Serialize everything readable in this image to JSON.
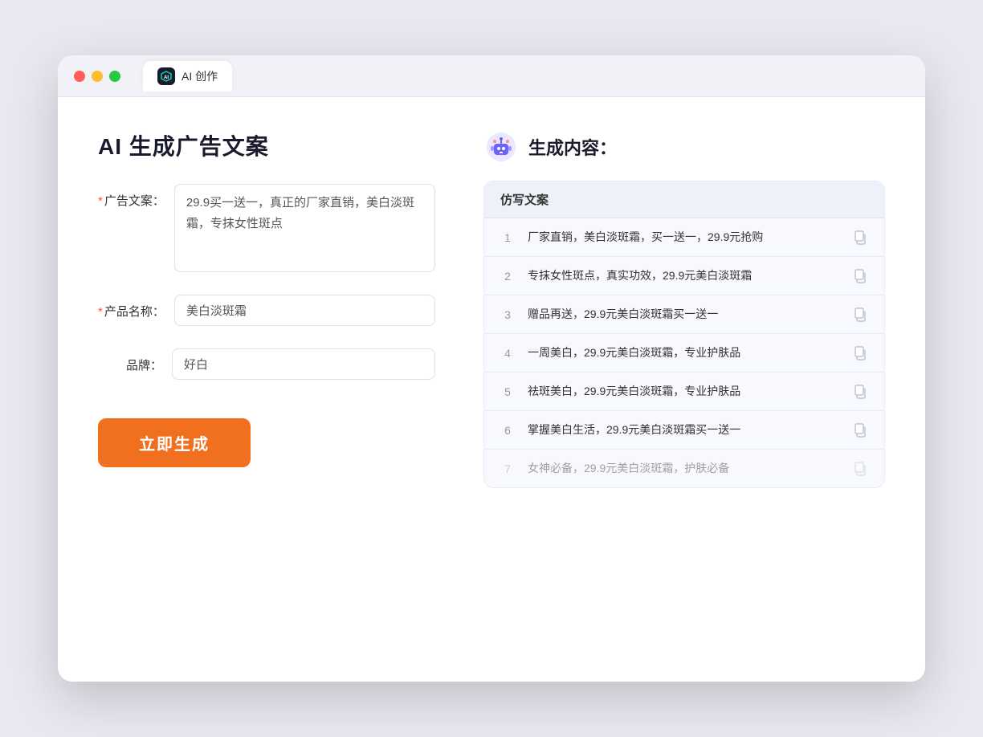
{
  "titlebar": {
    "tab_label": "AI 创作"
  },
  "left_panel": {
    "title": "AI 生成广告文案",
    "ad_copy_label": "广告文案：",
    "ad_copy_required": "*",
    "ad_copy_value": "29.9买一送一，真正的厂家直销，美白淡斑霜，专抹女性斑点",
    "product_name_label": "产品名称：",
    "product_name_required": "*",
    "product_name_value": "美白淡斑霜",
    "brand_label": "品牌：",
    "brand_value": "好白",
    "generate_button": "立即生成"
  },
  "right_panel": {
    "title": "生成内容：",
    "table_header": "仿写文案",
    "results": [
      {
        "id": 1,
        "text": "厂家直销，美白淡斑霜，买一送一，29.9元抢购"
      },
      {
        "id": 2,
        "text": "专抹女性斑点，真实功效，29.9元美白淡斑霜"
      },
      {
        "id": 3,
        "text": "赠品再送，29.9元美白淡斑霜买一送一"
      },
      {
        "id": 4,
        "text": "一周美白，29.9元美白淡斑霜，专业护肤品"
      },
      {
        "id": 5,
        "text": "祛斑美白，29.9元美白淡斑霜，专业护肤品"
      },
      {
        "id": 6,
        "text": "掌握美白生活，29.9元美白淡斑霜买一送一"
      },
      {
        "id": 7,
        "text": "女神必备，29.9元美白淡斑霜，护肤必备",
        "faded": true
      }
    ]
  }
}
